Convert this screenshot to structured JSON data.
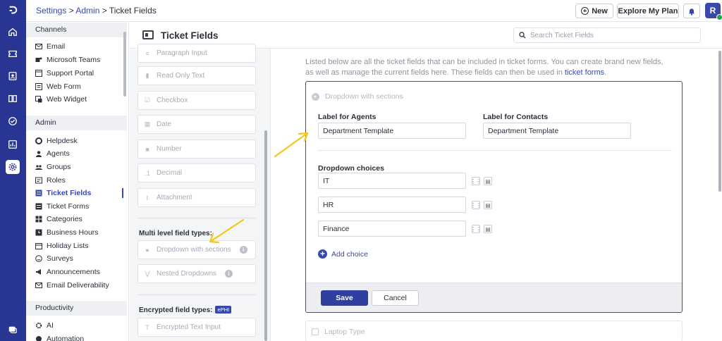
{
  "breadcrumb": {
    "settings": "Settings",
    "sep1": " > ",
    "admin": "Admin",
    "sep2": " > ",
    "current": "Ticket Fields"
  },
  "topbar": {
    "new_label": "New",
    "explore_label": "Explore My Plan",
    "avatar_initial": "R"
  },
  "sidebar": {
    "channels_heading": "Channels",
    "channels": [
      "Email",
      "Microsoft Teams",
      "Support Portal",
      "Web Form",
      "Web Widget"
    ],
    "admin_heading": "Admin",
    "admin_items": [
      "Helpdesk",
      "Agents",
      "Groups",
      "Roles",
      "Ticket Fields",
      "Ticket Forms",
      "Categories",
      "Business Hours",
      "Holiday Lists",
      "Surveys",
      "Announcements",
      "Email Deliverability"
    ],
    "active_item": "Ticket Fields",
    "productivity_heading": "Productivity",
    "productivity": [
      "AI",
      "Automation"
    ]
  },
  "page": {
    "title": "Ticket Fields",
    "search_placeholder": "Search Ticket Fields"
  },
  "palette": {
    "basic_fields": [
      "Paragraph Input",
      "Read Only Text",
      "Checkbox",
      "Date",
      "Number",
      "Decimal",
      "Attachment"
    ],
    "multi_level_label": "Multi level field types:",
    "multi_level_fields": [
      "Dropdown with sections",
      "Nested Dropdowns"
    ],
    "encrypted_label": "Encrypted field types:",
    "encrypted_badge": "ePHI",
    "encrypted_fields": [
      "Encrypted Text Input"
    ]
  },
  "main": {
    "description": "Listed below are all the ticket fields that can be included in ticket forms. You can create brand new fields, as well as manage the current fields here. These fields can then be used in ",
    "description_link": "ticket forms",
    "description_end": "."
  },
  "editor": {
    "field_type": "Dropdown with sections",
    "label_agents_title": "Label for Agents",
    "label_agents_value": "Department Template",
    "label_contacts_title": "Label for Contacts",
    "label_contacts_value": "Department Template",
    "choices_title": "Dropdown choices",
    "choices": [
      "IT",
      "HR",
      "Finance"
    ],
    "add_choice": "Add choice",
    "save": "Save",
    "cancel": "Cancel"
  },
  "next_field": {
    "label": "Laptop Type"
  },
  "colors": {
    "brand": "#283593",
    "accent": "#3949ab",
    "annotation_arrow": "#f5c518"
  }
}
